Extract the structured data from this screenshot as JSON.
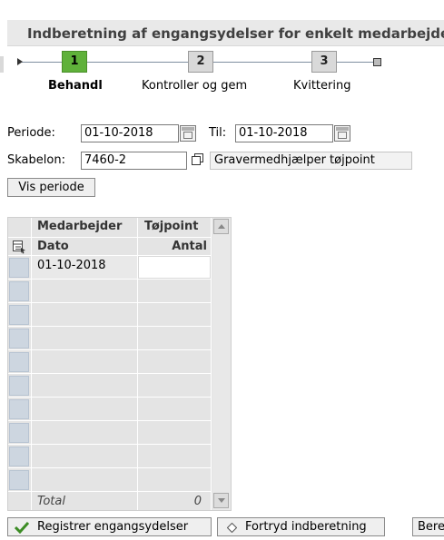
{
  "header": {
    "title": "Indberetning af engangsydelser for enkelt medarbejder"
  },
  "wizard": {
    "steps": [
      {
        "number": "1",
        "label": "Behandl"
      },
      {
        "number": "2",
        "label": "Kontroller og gem"
      },
      {
        "number": "3",
        "label": "Kvittering"
      }
    ]
  },
  "form": {
    "periode_label": "Periode:",
    "periode_value": "01-10-2018",
    "til_label": "Til:",
    "til_value": "01-10-2018",
    "skabelon_label": "Skabelon:",
    "skabelon_value": "7460-2",
    "skabelon_desc": "Gravermedhjælper tøjpoint",
    "vis_periode_label": "Vis periode"
  },
  "table": {
    "group_headers": [
      "Medarbejder",
      "Tøjpoint"
    ],
    "columns": [
      "Dato",
      "Antal"
    ],
    "rows": [
      {
        "dato": "01-10-2018",
        "antal": ""
      }
    ],
    "total_label": "Total",
    "total_value": "0"
  },
  "buttons": {
    "register": "Registrer engangsydelser",
    "cancel": "Fortryd indberetning",
    "next": "Beregn"
  },
  "colors": {
    "active_step": "#5fb13a",
    "check_icon": "#3c8c25"
  }
}
